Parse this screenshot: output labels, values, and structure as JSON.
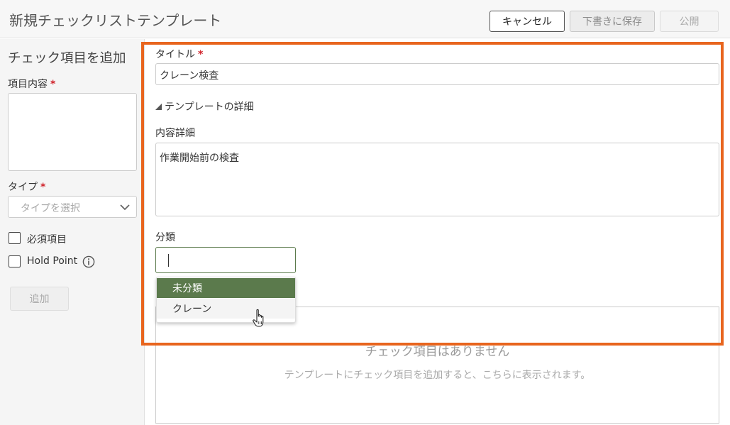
{
  "header": {
    "title": "新規チェックリストテンプレート",
    "cancel_label": "キャンセル",
    "save_draft_label": "下書きに保存",
    "publish_label": "公開"
  },
  "left_panel": {
    "title": "チェック項目を追加",
    "item_content_label": "項目内容",
    "required_mark": "*",
    "item_content_value": "",
    "type_label": "タイプ",
    "type_placeholder": "タイプを選択",
    "required_checkbox_label": "必須項目",
    "required_checked": false,
    "hold_point_label": "Hold Point",
    "hold_point_checked": false,
    "add_label": "追加"
  },
  "form": {
    "title_label": "タイトル",
    "title_value": "クレーン検査",
    "details_toggle_label": "テンプレートの詳細",
    "detail_label": "内容詳細",
    "detail_value": "作業開始前の検査",
    "category_label": "分類",
    "category_value": ""
  },
  "category_dropdown": {
    "options": [
      "未分類",
      "クレーン"
    ],
    "highlighted_option": "未分類"
  },
  "checklist_items": {
    "empty_title": "チェック項目はありません",
    "empty_description": "テンプレートにチェック項目を追加すると、こちらに表示されます。"
  },
  "colors": {
    "accent_green": "#5b7a4c",
    "highlight_orange": "#e8651e",
    "required_red": "#d0242c"
  },
  "icons": {
    "chevron": "chevron-down-icon",
    "info": "info-icon",
    "expand": "triangle-expanded-icon",
    "cursor": "hand-pointer-icon"
  }
}
